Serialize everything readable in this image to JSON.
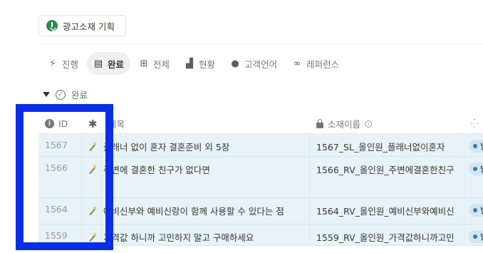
{
  "toolbar": {
    "plan_button_label": "광고소재 기획"
  },
  "tabs": [
    {
      "label": "진행",
      "icon": "⚡"
    },
    {
      "label": "완료",
      "icon": "▤",
      "active": true
    },
    {
      "label": "전체",
      "icon": "⊞"
    },
    {
      "label": "현황",
      "icon": "▟"
    },
    {
      "label": "고객언어",
      "icon": "●"
    },
    {
      "label": "레퍼런스",
      "icon": "∞"
    }
  ],
  "group": {
    "label": "완료",
    "color": "#448361"
  },
  "table": {
    "headers": {
      "id": "ID",
      "emoji": "✱",
      "title": "제목",
      "name": "소재이름",
      "status": "⁛"
    },
    "rows": [
      {
        "id": "1567",
        "title": "플래너 없이 혼자 결혼준비 외 5장",
        "name": "1567_SL_올인원_플래너없이혼자",
        "status": "발"
      },
      {
        "id": "1566",
        "title": "주변에 결혼한 친구가 없다면",
        "name": "1566_RV_올인원_주변에결혼한친구",
        "status": "발"
      },
      {
        "id": "1564",
        "title": "예비신부와 예비신랑이 함께 사용할 수 있다는 점",
        "name": "1564_RV_올인원_예비신부와예비신",
        "status": "발"
      },
      {
        "id": "1559",
        "title": "가격값 하니까 고민하지 말고 구매하세요",
        "name": "1559_RV_올인원_가격값하니까고민",
        "status": "발"
      }
    ]
  },
  "colors": {
    "highlight": "#0a2ee6",
    "row_bg": "#e8f2f9"
  }
}
